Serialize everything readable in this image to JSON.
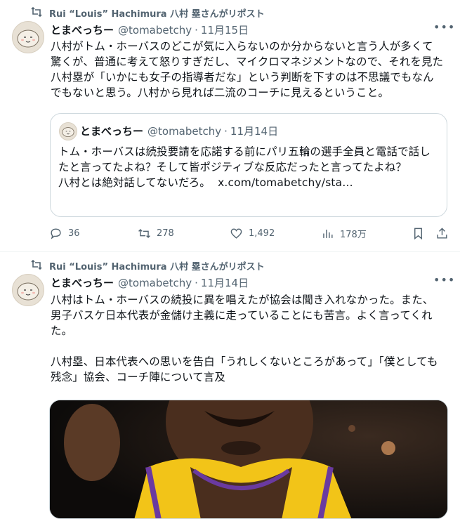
{
  "tweets": [
    {
      "repost_text": "Rui “Louis” Hachimura 八村 塁さんがリポスト",
      "author_name": "とまべっちー",
      "handle": "@tomabetchy",
      "date": "11月15日",
      "text": "八村がトム・ホーバスのどこが気に入らないのか分からないと言う人が多くて驚くが、普通に考えて怒りすぎだし、マイクロマネジメントなので、それを見た八村塁が「いかにも女子の指導者だな」という判断を下すのは不思議でもなんでもないと思う。八村から見れば二流のコーチに見えるということ。",
      "quote": {
        "author_name": "とまべっちー",
        "handle": "@tomabetchy",
        "date": "11月14日",
        "text": "トム・ホーバスは続投要請を応諾する前にパリ五輪の選手全員と電話で話したと言ってたよね？そして皆ポジティブな反応だったと言ってたよね？\n八村とは絶対話してないだろ。",
        "link": "x.com/tomabetchy/sta…"
      },
      "actions": {
        "replies": "36",
        "reposts": "278",
        "likes": "1,492",
        "views": "178万"
      }
    },
    {
      "repost_text": "Rui “Louis” Hachimura 八村 塁さんがリポスト",
      "author_name": "とまべっちー",
      "handle": "@tomabetchy",
      "date": "11月14日",
      "text": "八村はトム・ホーバスの続投に異を唱えたが協会は聞き入れなかった。また、男子バスケ日本代表が金儲け主義に走っていることにも苦言。よく言ってくれた。\n\n八村塁、日本代表への思いを告白「うれしくないところがあって」「僕としても残念」協会、コーチ陣について言及"
    }
  ],
  "colors": {
    "text": "#0f1419",
    "secondary": "#536471",
    "border": "#cfd9de",
    "divider": "#eff3f4"
  },
  "icons": [
    "repost-icon",
    "avatar",
    "more-icon",
    "reply-icon",
    "retweet-icon",
    "like-icon",
    "views-icon",
    "bookmark-icon",
    "share-icon"
  ]
}
